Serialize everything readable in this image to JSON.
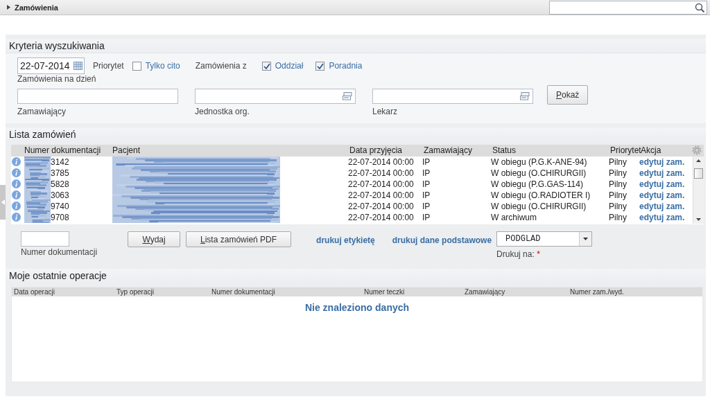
{
  "header": {
    "title": "Zamówienia"
  },
  "criteria": {
    "title": "Kryteria wyszukiwania",
    "date": {
      "value": "22-07-2014",
      "label": "Zamówienia na dzień"
    },
    "priority_label": "Priorytet",
    "priority_checks": [
      {
        "label": "Tylko cito",
        "checked": false
      }
    ],
    "source_label": "Zamówienia z",
    "source_checks": [
      {
        "label": "Oddział",
        "checked": true
      },
      {
        "label": "Poradnia",
        "checked": true
      }
    ],
    "fields": [
      {
        "label": "Zamawiający",
        "kind": "text"
      },
      {
        "label": "Jednostka org.",
        "kind": "picker"
      },
      {
        "label": "Lekarz",
        "kind": "picker"
      }
    ],
    "button": "Pokaż"
  },
  "orders": {
    "title": "Lista zamówień",
    "columns": [
      "Numer dokumentacji",
      "Pacjent",
      "Data przyjęcia",
      "Zamawiający",
      "Status",
      "Priorytet",
      "Akcja"
    ],
    "rows": [
      {
        "number": "3142",
        "date": "22-07-2014 00:00",
        "orderer": "IP",
        "status": "W obiegu (P.G.K-ANE-94)",
        "priority": "Pilny",
        "action": "edytuj zam."
      },
      {
        "number": "3785",
        "date": "22-07-2014 00:00",
        "orderer": "IP",
        "status": "W obiegu (O.CHIRURGII)",
        "priority": "Pilny",
        "action": "edytuj zam."
      },
      {
        "number": "5828",
        "date": "22-07-2014 00:00",
        "orderer": "IP",
        "status": "W obiegu (P.G.GAS-114)",
        "priority": "Pilny",
        "action": "edytuj zam."
      },
      {
        "number": "3063",
        "date": "22-07-2014 00:00",
        "orderer": "IP",
        "status": "W obiegu (O.RADIOTER I)",
        "priority": "Pilny",
        "action": "edytuj zam."
      },
      {
        "number": "9740",
        "date": "22-07-2014 00:00",
        "orderer": "IP",
        "status": "W obiegu (O.CHIRURGII)",
        "priority": "Pilny",
        "action": "edytuj zam."
      },
      {
        "number": "9708",
        "date": "22-07-2014 00:00",
        "orderer": "IP",
        "status": "W archiwum",
        "priority": "Pilny",
        "action": "edytuj zam."
      }
    ]
  },
  "actions": {
    "number_label": "Numer dokumentacji",
    "buttons": [
      "Wydaj",
      "Lista zamówień PDF"
    ],
    "links": [
      "drukuj etykietę",
      "drukuj dane podstawowe"
    ],
    "printer": {
      "value": "PODGLAD",
      "label": "Drukuj na:",
      "required": "*"
    }
  },
  "operations": {
    "title": "Moje ostatnie operacje",
    "columns": [
      "Data operacji",
      "Typ operacji",
      "Numer dokumentacji",
      "Numer teczki",
      "Zamawiający",
      "Numer zam./wyd."
    ],
    "empty_message": "Nie znaleziono danych"
  }
}
